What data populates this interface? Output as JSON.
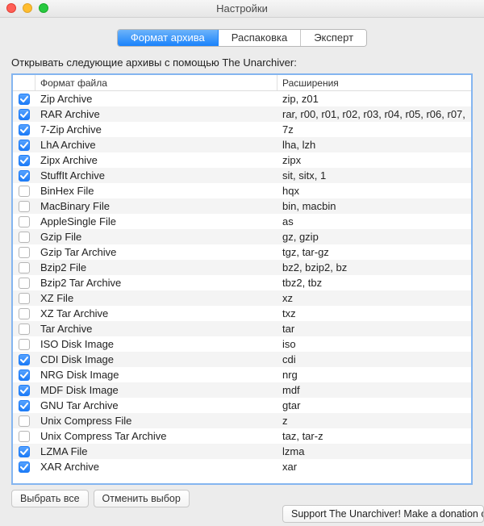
{
  "window": {
    "title": "Настройки"
  },
  "tabs": {
    "archive_format": "Формат архива",
    "unpack": "Распаковка",
    "expert": "Эксперт"
  },
  "instruction": "Открывать следующие архивы с помощью The Unarchiver:",
  "columns": {
    "checkbox": "",
    "format": "Формат файла",
    "extensions": "Расширения"
  },
  "formats": [
    {
      "checked": true,
      "name": "Zip Archive",
      "ext": "zip, z01"
    },
    {
      "checked": true,
      "name": "RAR Archive",
      "ext": "rar, r00, r01, r02, r03, r04, r05, r06, r07,"
    },
    {
      "checked": true,
      "name": "7-Zip Archive",
      "ext": "7z"
    },
    {
      "checked": true,
      "name": "LhA Archive",
      "ext": "lha, lzh"
    },
    {
      "checked": true,
      "name": "Zipx Archive",
      "ext": "zipx"
    },
    {
      "checked": true,
      "name": "StuffIt Archive",
      "ext": "sit, sitx, 1"
    },
    {
      "checked": false,
      "name": "BinHex File",
      "ext": "hqx"
    },
    {
      "checked": false,
      "name": "MacBinary File",
      "ext": "bin, macbin"
    },
    {
      "checked": false,
      "name": "AppleSingle File",
      "ext": "as"
    },
    {
      "checked": false,
      "name": "Gzip File",
      "ext": "gz, gzip"
    },
    {
      "checked": false,
      "name": "Gzip Tar Archive",
      "ext": "tgz, tar-gz"
    },
    {
      "checked": false,
      "name": "Bzip2 File",
      "ext": "bz2, bzip2, bz"
    },
    {
      "checked": false,
      "name": "Bzip2 Tar Archive",
      "ext": "tbz2, tbz"
    },
    {
      "checked": false,
      "name": "XZ File",
      "ext": "xz"
    },
    {
      "checked": false,
      "name": "XZ Tar Archive",
      "ext": "txz"
    },
    {
      "checked": false,
      "name": "Tar Archive",
      "ext": "tar"
    },
    {
      "checked": false,
      "name": "ISO Disk Image",
      "ext": "iso"
    },
    {
      "checked": true,
      "name": "CDI Disk Image",
      "ext": "cdi"
    },
    {
      "checked": true,
      "name": "NRG Disk Image",
      "ext": "nrg"
    },
    {
      "checked": true,
      "name": "MDF Disk Image",
      "ext": "mdf"
    },
    {
      "checked": true,
      "name": "GNU Tar Archive",
      "ext": "gtar"
    },
    {
      "checked": false,
      "name": "Unix Compress File",
      "ext": "z"
    },
    {
      "checked": false,
      "name": "Unix Compress Tar Archive",
      "ext": "taz, tar-z"
    },
    {
      "checked": true,
      "name": "LZMA File",
      "ext": "lzma"
    },
    {
      "checked": true,
      "name": "XAR Archive",
      "ext": "xar"
    }
  ],
  "buttons": {
    "select_all": "Выбрать все",
    "deselect_all": "Отменить выбор"
  },
  "support": "Support The Unarchiver! Make a donation on the"
}
